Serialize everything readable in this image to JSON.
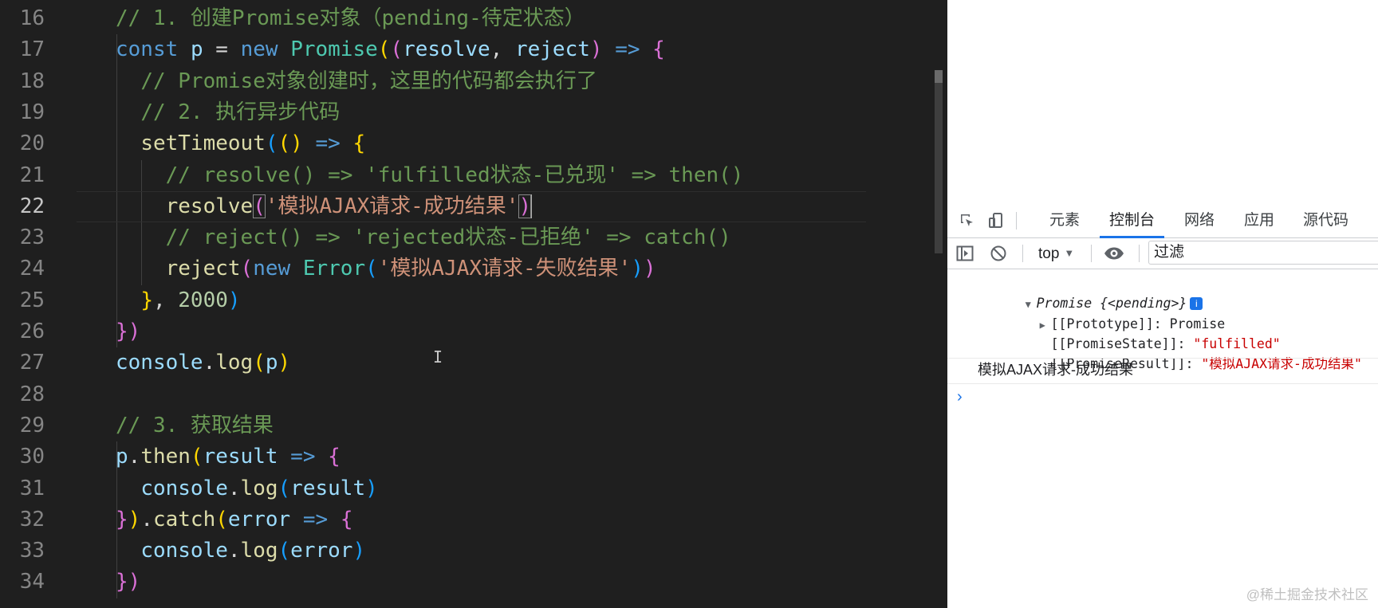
{
  "editor": {
    "active_line": 22,
    "lines": [
      {
        "n": 16,
        "tokens": [
          {
            "t": "// 1. 创建Promise对象（pending-待定状态）",
            "c": "cm"
          }
        ]
      },
      {
        "n": 17,
        "tokens": [
          {
            "t": "const",
            "c": "kw"
          },
          {
            "t": " ",
            "c": "op"
          },
          {
            "t": "p",
            "c": "var"
          },
          {
            "t": " = ",
            "c": "op"
          },
          {
            "t": "new",
            "c": "kw"
          },
          {
            "t": " ",
            "c": "op"
          },
          {
            "t": "Promise",
            "c": "cls"
          },
          {
            "t": "(",
            "c": "b1"
          },
          {
            "t": "(",
            "c": "b2"
          },
          {
            "t": "resolve",
            "c": "var"
          },
          {
            "t": ", ",
            "c": "op"
          },
          {
            "t": "reject",
            "c": "var"
          },
          {
            "t": ")",
            "c": "b2"
          },
          {
            "t": " ",
            "c": "op"
          },
          {
            "t": "=>",
            "c": "kw"
          },
          {
            "t": " ",
            "c": "op"
          },
          {
            "t": "{",
            "c": "b2"
          }
        ]
      },
      {
        "n": 18,
        "tokens": [
          {
            "t": "  ",
            "c": "op"
          },
          {
            "t": "// Promise对象创建时，这里的代码都会执行了",
            "c": "cm"
          }
        ]
      },
      {
        "n": 19,
        "tokens": [
          {
            "t": "  ",
            "c": "op"
          },
          {
            "t": "// 2. 执行异步代码",
            "c": "cm"
          }
        ]
      },
      {
        "n": 20,
        "tokens": [
          {
            "t": "  ",
            "c": "op"
          },
          {
            "t": "setTimeout",
            "c": "fn"
          },
          {
            "t": "(",
            "c": "b3"
          },
          {
            "t": "()",
            "c": "b1"
          },
          {
            "t": " ",
            "c": "op"
          },
          {
            "t": "=>",
            "c": "kw"
          },
          {
            "t": " ",
            "c": "op"
          },
          {
            "t": "{",
            "c": "b1"
          }
        ]
      },
      {
        "n": 21,
        "tokens": [
          {
            "t": "    ",
            "c": "op"
          },
          {
            "t": "// resolve() => 'fulfilled状态-已兑现' => then()",
            "c": "cm"
          }
        ]
      },
      {
        "n": 22,
        "tokens": [
          {
            "t": "    ",
            "c": "op"
          },
          {
            "t": "resolve",
            "c": "fn"
          },
          {
            "t": "(",
            "c": "b2"
          },
          {
            "t": "'模拟AJAX请求-成功结果'",
            "c": "str"
          },
          {
            "t": ")",
            "c": "b2"
          }
        ],
        "caret": true
      },
      {
        "n": 23,
        "tokens": [
          {
            "t": "    ",
            "c": "op"
          },
          {
            "t": "// reject() => 'rejected状态-已拒绝' => catch()",
            "c": "cm"
          }
        ]
      },
      {
        "n": 24,
        "tokens": [
          {
            "t": "    ",
            "c": "op"
          },
          {
            "t": "reject",
            "c": "fn"
          },
          {
            "t": "(",
            "c": "b2"
          },
          {
            "t": "new",
            "c": "kw"
          },
          {
            "t": " ",
            "c": "op"
          },
          {
            "t": "Error",
            "c": "cls"
          },
          {
            "t": "(",
            "c": "b3"
          },
          {
            "t": "'模拟AJAX请求-失败结果'",
            "c": "str"
          },
          {
            "t": ")",
            "c": "b3"
          },
          {
            "t": ")",
            "c": "b2"
          }
        ]
      },
      {
        "n": 25,
        "tokens": [
          {
            "t": "  ",
            "c": "op"
          },
          {
            "t": "}",
            "c": "b1"
          },
          {
            "t": ", ",
            "c": "op"
          },
          {
            "t": "2000",
            "c": "num"
          },
          {
            "t": ")",
            "c": "b3"
          }
        ]
      },
      {
        "n": 26,
        "tokens": [
          {
            "t": "})",
            "c": "b2"
          }
        ]
      },
      {
        "n": 27,
        "tokens": [
          {
            "t": "console",
            "c": "var"
          },
          {
            "t": ".",
            "c": "op"
          },
          {
            "t": "log",
            "c": "fn"
          },
          {
            "t": "(",
            "c": "b1"
          },
          {
            "t": "p",
            "c": "var"
          },
          {
            "t": ")",
            "c": "b1"
          }
        ]
      },
      {
        "n": 28,
        "tokens": []
      },
      {
        "n": 29,
        "tokens": [
          {
            "t": "// 3. 获取结果",
            "c": "cm"
          }
        ]
      },
      {
        "n": 30,
        "tokens": [
          {
            "t": "p",
            "c": "var"
          },
          {
            "t": ".",
            "c": "op"
          },
          {
            "t": "then",
            "c": "fn"
          },
          {
            "t": "(",
            "c": "b1"
          },
          {
            "t": "result",
            "c": "var"
          },
          {
            "t": " ",
            "c": "op"
          },
          {
            "t": "=>",
            "c": "kw"
          },
          {
            "t": " ",
            "c": "op"
          },
          {
            "t": "{",
            "c": "b2"
          }
        ]
      },
      {
        "n": 31,
        "tokens": [
          {
            "t": "  ",
            "c": "op"
          },
          {
            "t": "console",
            "c": "var"
          },
          {
            "t": ".",
            "c": "op"
          },
          {
            "t": "log",
            "c": "fn"
          },
          {
            "t": "(",
            "c": "b3"
          },
          {
            "t": "result",
            "c": "var"
          },
          {
            "t": ")",
            "c": "b3"
          }
        ]
      },
      {
        "n": 32,
        "tokens": [
          {
            "t": "}",
            "c": "b2"
          },
          {
            "t": ")",
            "c": "b1"
          },
          {
            "t": ".",
            "c": "op"
          },
          {
            "t": "catch",
            "c": "fn"
          },
          {
            "t": "(",
            "c": "b1"
          },
          {
            "t": "error",
            "c": "var"
          },
          {
            "t": " ",
            "c": "op"
          },
          {
            "t": "=>",
            "c": "kw"
          },
          {
            "t": " ",
            "c": "op"
          },
          {
            "t": "{",
            "c": "b2"
          }
        ]
      },
      {
        "n": 33,
        "tokens": [
          {
            "t": "  ",
            "c": "op"
          },
          {
            "t": "console",
            "c": "var"
          },
          {
            "t": ".",
            "c": "op"
          },
          {
            "t": "log",
            "c": "fn"
          },
          {
            "t": "(",
            "c": "b3"
          },
          {
            "t": "error",
            "c": "var"
          },
          {
            "t": ")",
            "c": "b3"
          }
        ]
      },
      {
        "n": 34,
        "tokens": [
          {
            "t": "})",
            "c": "b2"
          }
        ]
      }
    ]
  },
  "devtools": {
    "tabs": [
      "元素",
      "控制台",
      "网络",
      "应用",
      "源代码"
    ],
    "active_tab": "控制台",
    "context": "top",
    "filter_placeholder": "过滤",
    "console": {
      "promise_header": "Promise {<pending>}",
      "info_badge": "i",
      "prototype_row": "[[Prototype]]: Promise",
      "state_key": "[[PromiseState]]: ",
      "state_value": "\"fulfilled\"",
      "result_key": "[[PromiseResult]]: ",
      "result_value": "\"模拟AJAX请求-成功结果\"",
      "plain_log": "模拟AJAX请求-成功结果",
      "prompt": "›"
    }
  },
  "watermark": "@稀土掘金技术社区",
  "icons": [
    "inspect-element-icon",
    "device-toolbar-icon",
    "sidebar-toggle-icon",
    "clear-console-icon",
    "eye-icon",
    "dropdown-triangle-icon",
    "expand-triangle-icon",
    "info-icon",
    "text-cursor-icon"
  ]
}
